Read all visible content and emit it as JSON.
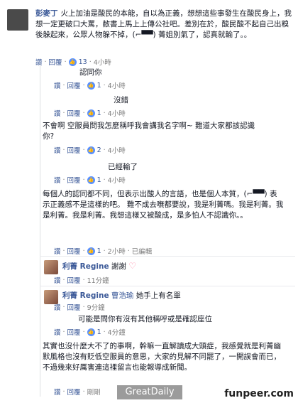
{
  "main": {
    "author": "彭麥丁",
    "text": "火上加油是酸民的本能，自以為正義，想想這些事發生在酸民身上，我想一定更破口大罵，敝書上馬上上傳公社吧。差別在於，酸民酸不起自己出糗後躲起來，公眾人物躲不掉，(⌐▀▀) 菁姐別氣了，認真就輸了。。",
    "actions": {
      "read": "讚",
      "reply": "回覆",
      "likes": "13",
      "time": "4小時"
    }
  },
  "replies": [
    {
      "text": "認同你",
      "actions": {
        "read": "讚",
        "reply": "回覆",
        "likes": "1",
        "time": "4小時"
      }
    },
    {
      "text": "沒錯",
      "actions": {
        "read": "讚",
        "reply": "回覆",
        "likes": "1",
        "time": "4小時"
      }
    },
    {
      "text": "不會啊 空服員問我怎麼稱呼我會講我名字啊~ 難道大家都該認識你?",
      "actions": {
        "read": "讚",
        "reply": "回覆",
        "likes": "2",
        "time": "4小時"
      }
    },
    {
      "text": "已經輸了",
      "actions": {
        "read": "讚",
        "reply": "回覆",
        "likes": "1",
        "time": "4小時"
      }
    },
    {
      "text": "每個人的認同都不同，但表示出酸人的言語，也是個人本質，(⌐▀▀) 表示正義感不是這樣的吧。 難不成去嘸都要說，我是利菁嗎。我是利菁。我是利菁。我是利菁。我想這樣又被酸成，是多怕人不認識你。。",
      "actions": {
        "read": "讚",
        "reply": "回覆",
        "likes": "1",
        "time": "2小時",
        "edited": "已編輯"
      }
    },
    {
      "author": "利菁 Regine",
      "text": "謝謝",
      "actions": {
        "read": "讚",
        "reply": "回覆",
        "time": "11分鐘"
      }
    },
    {
      "author": "利菁 Regine",
      "mention": "曹浩瑜",
      "text": "她手上有名單",
      "actions": {
        "read": "讚",
        "reply": "回覆",
        "time": "9分鐘"
      }
    },
    {
      "text": "可能是問你有沒有其他稱呼或是確認座位",
      "actions": {
        "read": "讚",
        "reply": "回覆",
        "likes": "1",
        "time": "4分鐘"
      }
    },
    {
      "text": "其實也沒什麼大不了的事啊，幹嘛一直解讀成大頭症，我感覺就是利菁幽默風格也沒有貶低空服員的意思，大家的見解不同罷了，一開誤會而已，不過幾來好厲害連這裡留言也能報導成新聞。",
      "actions": {
        "read": "讚",
        "reply": "回覆",
        "time": "剛剛"
      }
    }
  ],
  "watermarks": {
    "left": "GreatDaily",
    "right": "funpeer.com"
  },
  "colors": {
    "link": "#3b5998",
    "meta": "#7f7f7f",
    "like": "#5890ff",
    "heart": "#ff7f9f"
  },
  "icons": [
    "thumb-like-icon",
    "heart-icon"
  ]
}
